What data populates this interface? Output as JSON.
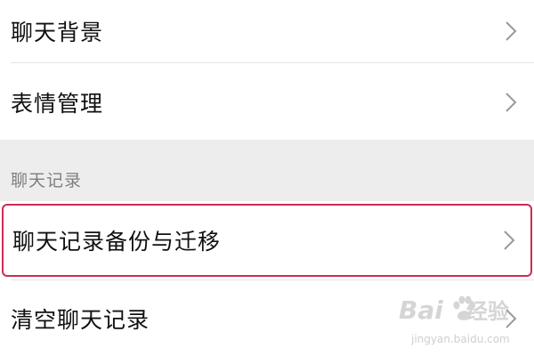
{
  "settings": {
    "items_top": [
      {
        "label": "聊天背景"
      },
      {
        "label": "表情管理"
      }
    ],
    "section_header": "聊天记录",
    "items_bottom": [
      {
        "label": "聊天记录备份与迁移"
      },
      {
        "label": "清空聊天记录"
      }
    ]
  },
  "watermark": {
    "logo_text": "Bai",
    "logo_text_2": "经验",
    "url": "jingyan.baidu.com"
  },
  "colors": {
    "highlight_border": "#cf2b54",
    "background": "#ededed",
    "section_header_text": "#7f7f7f"
  },
  "icons": {
    "row_arrow": "chevron-right-icon",
    "watermark": "baidu-paw-icon"
  }
}
